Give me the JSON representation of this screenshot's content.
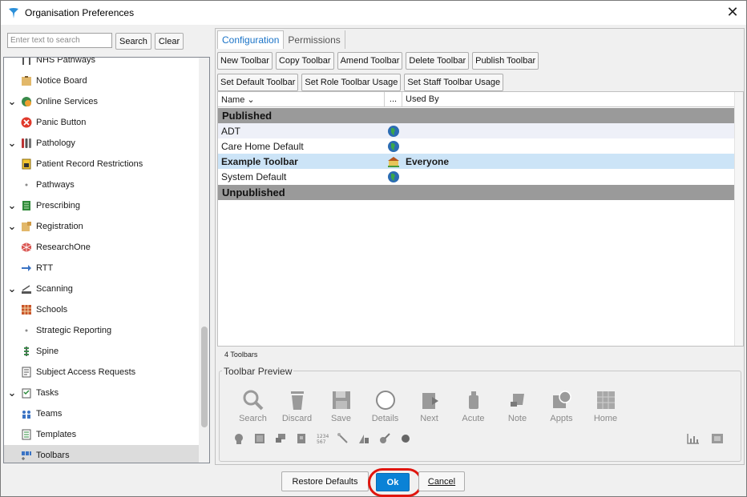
{
  "window": {
    "title": "Organisation Preferences",
    "close": "✕"
  },
  "search": {
    "placeholder": "Enter text to search",
    "value": "",
    "search_label": "Search",
    "clear_label": "Clear"
  },
  "tree": [
    {
      "label": "NHS Pathways",
      "expandable": false,
      "icon": "pathways-icon"
    },
    {
      "label": "Notice Board",
      "expandable": false,
      "icon": "notice-board-icon"
    },
    {
      "label": "Online Services",
      "expandable": true,
      "icon": "online-services-icon"
    },
    {
      "label": "Panic Button",
      "expandable": false,
      "icon": "panic-button-icon"
    },
    {
      "label": "Pathology",
      "expandable": true,
      "icon": "pathology-icon"
    },
    {
      "label": "Patient Record Restrictions",
      "expandable": false,
      "icon": "lock-icon"
    },
    {
      "label": "Pathways",
      "expandable": false,
      "icon": "dot-icon"
    },
    {
      "label": "Prescribing",
      "expandable": true,
      "icon": "prescribing-icon"
    },
    {
      "label": "Registration",
      "expandable": true,
      "icon": "registration-icon"
    },
    {
      "label": "ResearchOne",
      "expandable": false,
      "icon": "research-icon"
    },
    {
      "label": "RTT",
      "expandable": false,
      "icon": "arrow-right-icon"
    },
    {
      "label": "Scanning",
      "expandable": true,
      "icon": "scanner-icon"
    },
    {
      "label": "Schools",
      "expandable": false,
      "icon": "school-icon"
    },
    {
      "label": "Strategic Reporting",
      "expandable": false,
      "icon": "dot-icon"
    },
    {
      "label": "Spine",
      "expandable": false,
      "icon": "spine-icon"
    },
    {
      "label": "Subject Access Requests",
      "expandable": false,
      "icon": "document-icon"
    },
    {
      "label": "Tasks",
      "expandable": true,
      "icon": "tasks-icon"
    },
    {
      "label": "Teams",
      "expandable": false,
      "icon": "teams-icon"
    },
    {
      "label": "Templates",
      "expandable": false,
      "icon": "templates-icon"
    },
    {
      "label": "Toolbars",
      "expandable": false,
      "icon": "toolbars-icon",
      "selected": true
    }
  ],
  "tabs": [
    {
      "label": "Configuration",
      "active": true
    },
    {
      "label": "Permissions",
      "active": false
    }
  ],
  "toolbar_actions_row1": [
    "New Toolbar",
    "Copy Toolbar",
    "Amend Toolbar",
    "Delete Toolbar",
    "Publish Toolbar"
  ],
  "toolbar_actions_row2": [
    "Set Default Toolbar",
    "Set Role Toolbar Usage",
    "Set Staff Toolbar Usage"
  ],
  "grid": {
    "columns": {
      "name": "Name ⌄",
      "dots": "...",
      "used_by": "Used By"
    },
    "groups": [
      {
        "label": "Published"
      },
      {
        "label": "Unpublished"
      }
    ],
    "rows": [
      {
        "name": "ADT",
        "icon": "globe-icon",
        "used_by": ""
      },
      {
        "name": "Care Home Default",
        "icon": "globe-icon",
        "used_by": ""
      },
      {
        "name": "Example Toolbar",
        "icon": "building-icon",
        "used_by": "Everyone",
        "selected": true
      },
      {
        "name": "System Default",
        "icon": "globe-icon",
        "used_by": ""
      }
    ]
  },
  "status_text": "4 Toolbars",
  "preview": {
    "legend": "Toolbar Preview",
    "buttons": [
      {
        "label": "Search",
        "icon": "magnifier-icon"
      },
      {
        "label": "Discard",
        "icon": "trash-icon"
      },
      {
        "label": "Save",
        "icon": "floppy-icon"
      },
      {
        "label": "Details",
        "icon": "circle-icon"
      },
      {
        "label": "Next",
        "icon": "next-icon"
      },
      {
        "label": "Acute",
        "icon": "bottle-icon"
      },
      {
        "label": "Note",
        "icon": "note-icon"
      },
      {
        "label": "Appts",
        "icon": "appts-icon"
      },
      {
        "label": "Home",
        "icon": "grid-icon"
      }
    ]
  },
  "footer": {
    "restore_label": "Restore Defaults",
    "ok_label": "Ok",
    "cancel_label": "Cancel"
  },
  "colors": {
    "accent": "#0a82d6",
    "highlight_ring": "#e0150e",
    "selected_row": "#cce4f7",
    "group_bar": "#9a9a9a"
  }
}
